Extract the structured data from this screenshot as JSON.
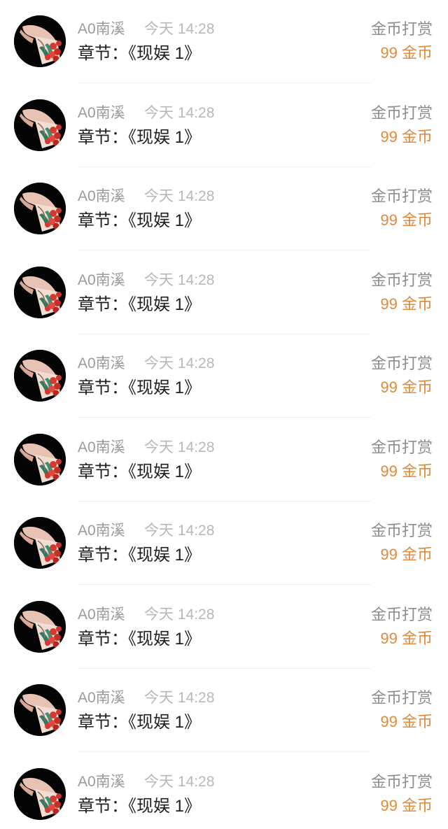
{
  "colors": {
    "amount": "#e08a3c",
    "name": "#9b9b9b",
    "time": "#b8b8b8",
    "chapter": "#1f1f1f",
    "type": "#8e8e8e"
  },
  "records": [
    {
      "username": "A0南溪",
      "time": "今天 14:28",
      "chapter": "章节：《现娱 1》",
      "reward_type": "金币打赏",
      "amount": "99 金币",
      "avatar_icon": "rose-bouquet-avatar"
    },
    {
      "username": "A0南溪",
      "time": "今天 14:28",
      "chapter": "章节：《现娱 1》",
      "reward_type": "金币打赏",
      "amount": "99 金币",
      "avatar_icon": "rose-bouquet-avatar"
    },
    {
      "username": "A0南溪",
      "time": "今天 14:28",
      "chapter": "章节：《现娱 1》",
      "reward_type": "金币打赏",
      "amount": "99 金币",
      "avatar_icon": "rose-bouquet-avatar"
    },
    {
      "username": "A0南溪",
      "time": "今天 14:28",
      "chapter": "章节：《现娱 1》",
      "reward_type": "金币打赏",
      "amount": "99 金币",
      "avatar_icon": "rose-bouquet-avatar"
    },
    {
      "username": "A0南溪",
      "time": "今天 14:28",
      "chapter": "章节：《现娱 1》",
      "reward_type": "金币打赏",
      "amount": "99 金币",
      "avatar_icon": "rose-bouquet-avatar"
    },
    {
      "username": "A0南溪",
      "time": "今天 14:28",
      "chapter": "章节：《现娱 1》",
      "reward_type": "金币打赏",
      "amount": "99 金币",
      "avatar_icon": "rose-bouquet-avatar"
    },
    {
      "username": "A0南溪",
      "time": "今天 14:28",
      "chapter": "章节：《现娱 1》",
      "reward_type": "金币打赏",
      "amount": "99 金币",
      "avatar_icon": "rose-bouquet-avatar"
    },
    {
      "username": "A0南溪",
      "time": "今天 14:28",
      "chapter": "章节：《现娱 1》",
      "reward_type": "金币打赏",
      "amount": "99 金币",
      "avatar_icon": "rose-bouquet-avatar"
    },
    {
      "username": "A0南溪",
      "time": "今天 14:28",
      "chapter": "章节：《现娱 1》",
      "reward_type": "金币打赏",
      "amount": "99 金币",
      "avatar_icon": "rose-bouquet-avatar"
    },
    {
      "username": "A0南溪",
      "time": "今天 14:28",
      "chapter": "章节：《现娱 1》",
      "reward_type": "金币打赏",
      "amount": "99 金币",
      "avatar_icon": "rose-bouquet-avatar"
    }
  ]
}
